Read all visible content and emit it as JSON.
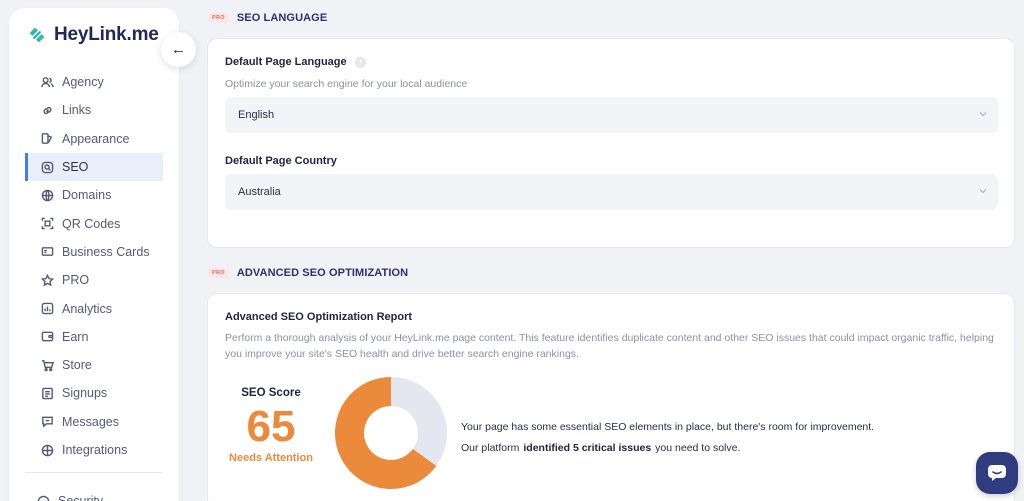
{
  "brand": {
    "name": "HeyLink.me",
    "accent": "#3d7df0",
    "logo_color": "#2fb8a6"
  },
  "sidebar": {
    "items": [
      {
        "label": "Agency",
        "icon": "users-icon"
      },
      {
        "label": "Links",
        "icon": "link-icon"
      },
      {
        "label": "Appearance",
        "icon": "palette-icon"
      },
      {
        "label": "SEO",
        "icon": "seo-search-icon",
        "active": true
      },
      {
        "label": "Domains",
        "icon": "globe-icon"
      },
      {
        "label": "QR Codes",
        "icon": "qr-code-icon"
      },
      {
        "label": "Business Cards",
        "icon": "business-card-icon"
      },
      {
        "label": "PRO",
        "icon": "star-icon"
      },
      {
        "label": "Analytics",
        "icon": "analytics-icon"
      },
      {
        "label": "Earn",
        "icon": "wallet-icon"
      },
      {
        "label": "Store",
        "icon": "cart-icon"
      },
      {
        "label": "Signups",
        "icon": "signup-icon"
      },
      {
        "label": "Messages",
        "icon": "messages-icon"
      },
      {
        "label": "Integrations",
        "icon": "integrations-icon"
      }
    ],
    "cut_item": "Security"
  },
  "seo_language": {
    "badge": "PRO",
    "title": "SEO LANGUAGE",
    "language_label": "Default Page Language",
    "language_desc": "Optimize your search engine for your local audience",
    "language_value": "English",
    "country_label": "Default Page Country",
    "country_value": "Australia"
  },
  "advanced_seo": {
    "badge": "PRO",
    "title": "ADVANCED SEO OPTIMIZATION",
    "report_title": "Advanced SEO Optimization Report",
    "report_desc": "Perform a thorough analysis of your HeyLink.me page content. This feature identifies duplicate content and other SEO issues that could impact organic traffic, helping you improve your site's SEO health and drive better search engine rankings.",
    "score_label": "SEO Score",
    "score_value": "65",
    "score_status": "Needs Attention",
    "score_fraction": 0.65,
    "score_color": "#ec8a3c",
    "remainder_color": "#e4e6f0",
    "summary_line1": "Your page has some essential SEO elements in place, but there's room for improvement.",
    "summary_line2_prefix": "Our platform",
    "summary_line2_bold": "identified 5 critical issues",
    "summary_line2_suffix": "you need to solve."
  }
}
